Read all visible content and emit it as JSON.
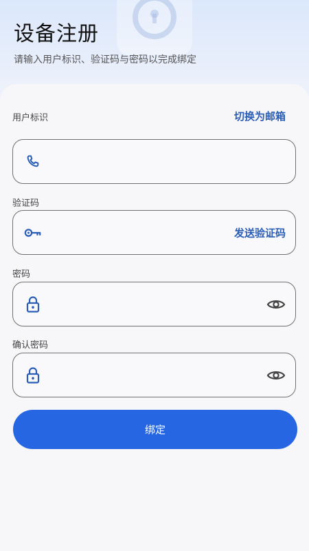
{
  "header": {
    "title": "设备注册",
    "subtitle": "请输入用户标识、验证码与密码以完成绑定"
  },
  "form": {
    "user_id": {
      "label": "用户标识",
      "switch_label": "切换为邮箱",
      "icon": "phone-icon",
      "value": ""
    },
    "verification_code": {
      "label": "验证码",
      "send_label": "发送验证码",
      "icon": "key-icon",
      "value": ""
    },
    "password": {
      "label": "密码",
      "icon": "lock-icon",
      "toggle_icon": "eye-icon",
      "value": ""
    },
    "confirm_password": {
      "label": "确认密码",
      "icon": "lock-icon",
      "toggle_icon": "eye-icon",
      "value": ""
    },
    "submit_label": "绑定"
  },
  "colors": {
    "accent": "#2766e3",
    "link": "#2a5db5",
    "icon": "#2a5db5"
  }
}
